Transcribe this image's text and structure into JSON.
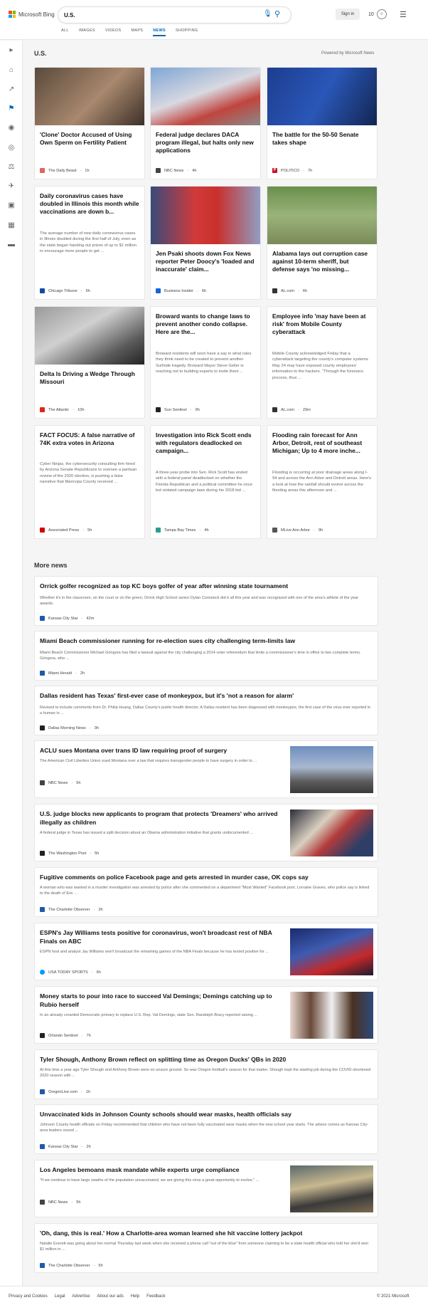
{
  "header": {
    "logo_text": "Microsoft Bing",
    "search_value": "U.S.",
    "sign_in": "Sign in",
    "rewards_points": "10",
    "rewards_icon": "trophy-icon",
    "tabs": [
      "ALL",
      "IMAGES",
      "VIDEOS",
      "MAPS",
      "NEWS",
      "SHOPPING"
    ],
    "active_tab": "NEWS"
  },
  "section": {
    "title": "U.S.",
    "powered_by": "Powered by Microsoft News"
  },
  "cards": [
    {
      "title": "'Clone' Doctor Accused of Using Own Sperm on Fertility Patient",
      "snippet": "",
      "source": "The Daily Beast",
      "time": "1h",
      "logo_color": "#e0645e"
    },
    {
      "title": "Federal judge declares DACA program illegal, but halts only new applications",
      "snippet": "",
      "source": "NBC News",
      "time": "4h",
      "logo_color": "#444444"
    },
    {
      "title": "The battle for the 50-50 Senate takes shape",
      "snippet": "",
      "source": "POLITICO",
      "time": "7h",
      "logo_color": "#c8102e"
    },
    {
      "title": "Daily coronavirus cases have doubled in Illinois this month while vaccinations are down b...",
      "snippet": "The average number of new daily coronavirus cases in Illinois doubled during the first half of July, even as the state began handing out prizes of up to $1 million to encourage more people to get ...",
      "source": "Chicago Tribune",
      "time": "6h",
      "logo_color": "#0b4ea2"
    },
    {
      "title": "Jen Psaki shoots down Fox News reporter Peter Doocy's 'loaded and inaccurate' claim...",
      "snippet": "",
      "source": "Business Insider",
      "time": "6h",
      "logo_color": "#1565d8"
    },
    {
      "title": "Alabama lays out corruption case against 10-term sheriff, but defense says 'no missing...",
      "snippet": "",
      "source": "AL.com",
      "time": "6h",
      "logo_color": "#333333"
    },
    {
      "title": "Delta Is Driving a Wedge Through Missouri",
      "snippet": "",
      "source": "The Atlantic",
      "time": "10h",
      "logo_color": "#e2231a"
    },
    {
      "title": "Broward wants to change laws to prevent another condo collapse. Here are the...",
      "snippet": "Broward residents will soon have a say in what rules they think need to be created to prevent another Surfside tragedy. Broward Mayor Steve Geller is reaching out to building experts to invite them ...",
      "source": "Sun Sentinel",
      "time": "9h",
      "logo_color": "#222222"
    },
    {
      "title": "Employee info 'may have been at risk' from Mobile County cyberattack",
      "snippet": "Mobile County acknowledged Friday that a cyberattack targeting the county's computer systems May 24 may have exposed county employees' information to the hackers. \"Through the forensics process, thus ...",
      "source": "AL.com",
      "time": "29m",
      "logo_color": "#333333"
    },
    {
      "title": "FACT FOCUS: A false narrative of 74K extra votes in Arizona",
      "snippet": "Cyber Ninjas, the cybersecurity consulting firm hired by Arizona Senate Republicans to oversee a partisan review of the 2020 election, is pushing a false narrative that Maricopa County received ...",
      "source": "Associated Press",
      "time": "5h",
      "logo_color": "#d60000"
    },
    {
      "title": "Investigation into Rick Scott ends with regulators deadlocked on campaign...",
      "snippet": "A three-year probe into Sen. Rick Scott has ended with a federal panel deadlocked on whether the Florida Republican and a political committee he once led violated campaign laws during his 2018 bid ...",
      "source": "Tampa Bay Times",
      "time": "4h",
      "logo_color": "#2a9d8f"
    },
    {
      "title": "Flooding rain forecast for Ann Arbor, Detroit, rest of southeast Michigan; Up to 4 more inche...",
      "snippet": "Flooding is occurring at poor drainage areas along I-94 and across the Ann Arbor and Detroit areas. Here's a look at how the rainfall should evolve across the flooding areas this afternoon and ...",
      "source": "MLive Ann Arbor",
      "time": "9h",
      "logo_color": "#555555"
    }
  ],
  "more_news": {
    "title": "More news",
    "items": [
      {
        "title": "Orrick golfer recognized as top KC boys golfer of year after winning state tournament",
        "snippet": "Whether it's in the classroom, on the court or on the green, Orrick High School senior Dylan Comstock did it all this year and was recognized with one of the area's athlete of the year awards.",
        "source": "Kansas City Star",
        "time": "42m",
        "logo_color": "#1f5aa6"
      },
      {
        "title": "Miami Beach commissioner running for re-election sues city challenging term-limits law",
        "snippet": "Miami Beach Commissioner Michael Góngora has filed a lawsuit against the city challenging a 2014 voter referendum that limits a commissioner's time in office to two complete terms. Góngora, who ...",
        "source": "Miami Herald",
        "time": "2h",
        "logo_color": "#1f5aa6"
      },
      {
        "title": "Dallas resident has Texas' first-ever case of monkeypox, but it's 'not a reason for alarm'",
        "snippet": "Revised to include comments from Dr. Philip Huang, Dallas County's public health director. A Dallas resident has been diagnosed with monkeypox, the first case of the virus ever reported in a human in ...",
        "source": "Dallas Morning News",
        "time": "3h",
        "logo_color": "#222222"
      },
      {
        "title": "ACLU sues Montana over trans ID law requiring proof of surgery",
        "snippet": "The American Civil Liberties Union sued Montana over a law that requires transgender people to have surgery in order to ...",
        "source": "NBC News",
        "time": "5h",
        "logo_color": "#444444"
      },
      {
        "title": "U.S. judge blocks new applicants to program that protects 'Dreamers' who arrived illegally as children",
        "snippet": "A federal judge in Texas has issued a split decision about an Obama administration initiative that grants undocumented ...",
        "source": "The Washington Post",
        "time": "5h",
        "logo_color": "#222222"
      },
      {
        "title": "Fugitive comments on police Facebook page and gets arrested in murder case, OK cops say",
        "snippet": "A woman who was wanted in a murder investigation was arrested by police after she commented on a department \"Most Wanted\" Facebook post. Lorraine Graves, who police say is linked to the death of Eric ...",
        "source": "The Charlotte Observer",
        "time": "3h",
        "logo_color": "#1f5aa6"
      },
      {
        "title": "ESPN's Jay Williams tests positive for coronavirus, won't broadcast rest of NBA Finals on ABC",
        "snippet": "ESPN host and analyst Jay Williams won't broadcast the remaining games of the NBA Finals because he has tested positive for ...",
        "source": "USA TODAY SPORTS",
        "time": "6h",
        "logo_color": "#009bff"
      },
      {
        "title": "Money starts to pour into race to succeed Val Demings; Demings catching up to Rubio herself",
        "snippet": "In an already crowded Democratic primary to replace U.S. Rep. Val Demings, state Sen. Randolph Bracy reported raising ...",
        "source": "Orlando Sentinel",
        "time": "7h",
        "logo_color": "#222222"
      },
      {
        "title": "Tyler Shough, Anthony Brown reflect on splitting time as Oregon Ducks' QBs in 2020",
        "snippet": "At this time a year ago Tyler Shough and Anthony Brown were on unsure ground. So was Oregon football's season for that matter. Shough kept the starting job during the COVID-shortened 2020 season with ...",
        "source": "OregonLive.com",
        "time": "1h",
        "logo_color": "#1f5aa6"
      },
      {
        "title": "Unvaccinated kids in Johnson County schools should wear masks, health officials say",
        "snippet": "Johnson County health officials on Friday recommended that children who have not been fully vaccinated wear masks when the new school year starts. The advice comes as Kansas City-area leaders sound ...",
        "source": "Kansas City Star",
        "time": "2h",
        "logo_color": "#1f5aa6"
      },
      {
        "title": "Los Angeles bemoans mask mandate while experts urge compliance",
        "snippet": "\"If we continue to have large swaths of the population unvaccinated, we are giving this virus a great opportunity to evolve,\" ...",
        "source": "NBC News",
        "time": "5h",
        "logo_color": "#444444"
      },
      {
        "title": "'Oh, dang, this is real.' How a Charlotte-area woman learned she hit vaccine lottery jackpot",
        "snippet": "Natalie Everett was going about her normal Thursday last week when she received a phone call \"out of the blue\" from someone claiming to be a state health official who told her she'd won $1 million in ...",
        "source": "The Charlotte Observer",
        "time": "5h",
        "logo_color": "#1f5aa6"
      }
    ]
  },
  "footer": {
    "links": [
      "Privacy and Cookies",
      "Legal",
      "Advertise",
      "About our ads",
      "Help",
      "Feedback"
    ],
    "copyright": "© 2021 Microsoft"
  },
  "colors": {
    "accent": "#0067b8",
    "background": "#f5f5f5"
  }
}
